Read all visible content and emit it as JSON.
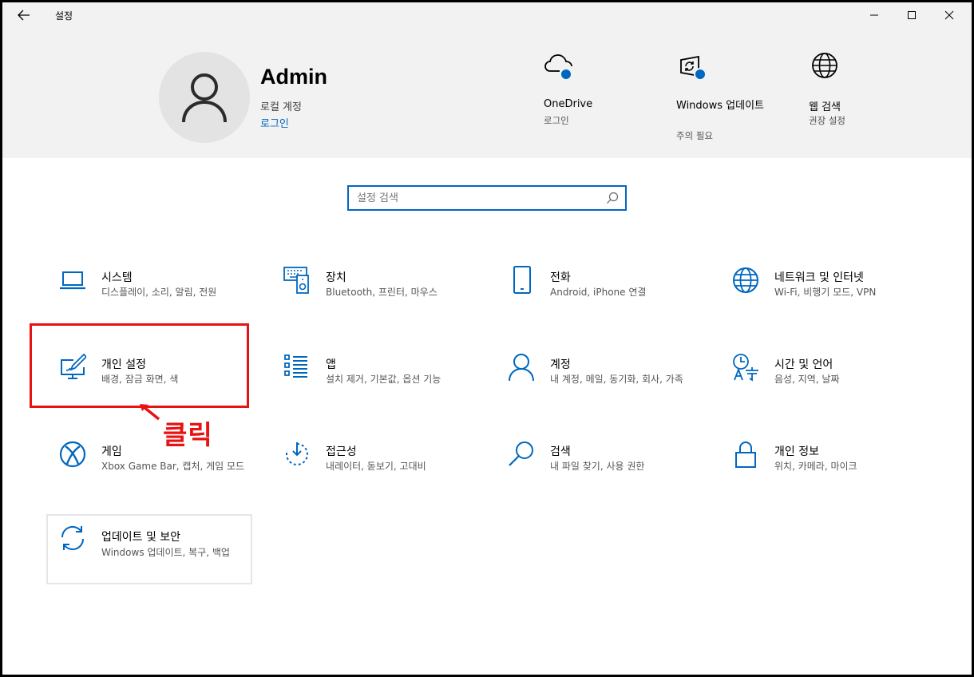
{
  "titlebar": {
    "title": "설정",
    "back_icon": "arrow-left-icon",
    "minimize_icon": "minimize-icon",
    "maximize_icon": "maximize-icon",
    "close_icon": "close-icon"
  },
  "user": {
    "name": "Admin",
    "account_type": "로컬 계정",
    "login_link": "로그인",
    "avatar_icon": "user-avatar-icon"
  },
  "quick_links": [
    {
      "title": "OneDrive",
      "subtitle": "로그인",
      "icon": "onedrive-cloud-icon"
    },
    {
      "title": "Windows 업데이트",
      "subtitle": "주의 필요",
      "icon": "windows-update-icon"
    },
    {
      "title": "웹 검색",
      "subtitle": "권장 설정",
      "icon": "globe-icon"
    }
  ],
  "search": {
    "placeholder": "설정 검색",
    "icon": "search-icon"
  },
  "categories": [
    {
      "title": "시스템",
      "subtitle": "디스플레이, 소리, 알림, 전원",
      "icon": "laptop-icon"
    },
    {
      "title": "장치",
      "subtitle": "Bluetooth, 프린터, 마우스",
      "icon": "devices-icon"
    },
    {
      "title": "전화",
      "subtitle": "Android, iPhone 연결",
      "icon": "phone-icon"
    },
    {
      "title": "네트워크 및 인터넷",
      "subtitle": "Wi-Fi, 비행기 모드, VPN",
      "icon": "globe-icon"
    },
    {
      "title": "개인 설정",
      "subtitle": "배경, 잠금 화면, 색",
      "icon": "personalization-icon"
    },
    {
      "title": "앱",
      "subtitle": "설치 제거, 기본값, 옵션 기능",
      "icon": "apps-list-icon"
    },
    {
      "title": "계정",
      "subtitle": "내 계정, 메일, 동기화, 회사, 가족",
      "icon": "person-icon"
    },
    {
      "title": "시간 및 언어",
      "subtitle": "음성, 지역, 날짜",
      "icon": "time-language-icon"
    },
    {
      "title": "게임",
      "subtitle": "Xbox Game Bar, 캡처, 게임 모드",
      "icon": "xbox-icon"
    },
    {
      "title": "접근성",
      "subtitle": "내레이터, 돋보기, 고대비",
      "icon": "accessibility-timer-icon"
    },
    {
      "title": "검색",
      "subtitle": "내 파일 찾기, 사용 권한",
      "icon": "search-icon"
    },
    {
      "title": "개인 정보",
      "subtitle": "위치, 카메라, 마이크",
      "icon": "lock-icon"
    },
    {
      "title": "업데이트 및 보안",
      "subtitle": "Windows 업데이트, 복구, 백업",
      "icon": "sync-icon"
    }
  ],
  "annotation": {
    "label": "클릭",
    "color": "#e81212"
  },
  "colors": {
    "accent": "#0067c0",
    "header_bg": "#f2f2f2"
  }
}
